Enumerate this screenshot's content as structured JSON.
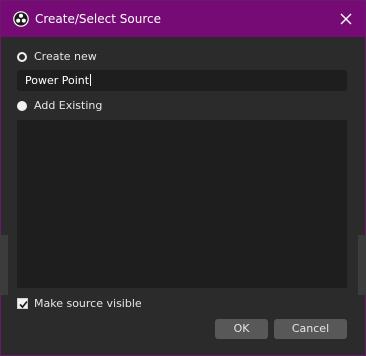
{
  "window": {
    "title": "Create/Select Source",
    "app_icon": "obs-logo-icon",
    "close_icon": "close-icon",
    "accent_color": "#760b76"
  },
  "options": {
    "create_new_label": "Create new",
    "create_new_selected": true,
    "source_name_value": "Power Point",
    "add_existing_label": "Add Existing",
    "add_existing_selected": false,
    "existing_sources": []
  },
  "footer": {
    "make_visible_label": "Make source visible",
    "make_visible_checked": true,
    "ok_label": "OK",
    "cancel_label": "Cancel"
  }
}
